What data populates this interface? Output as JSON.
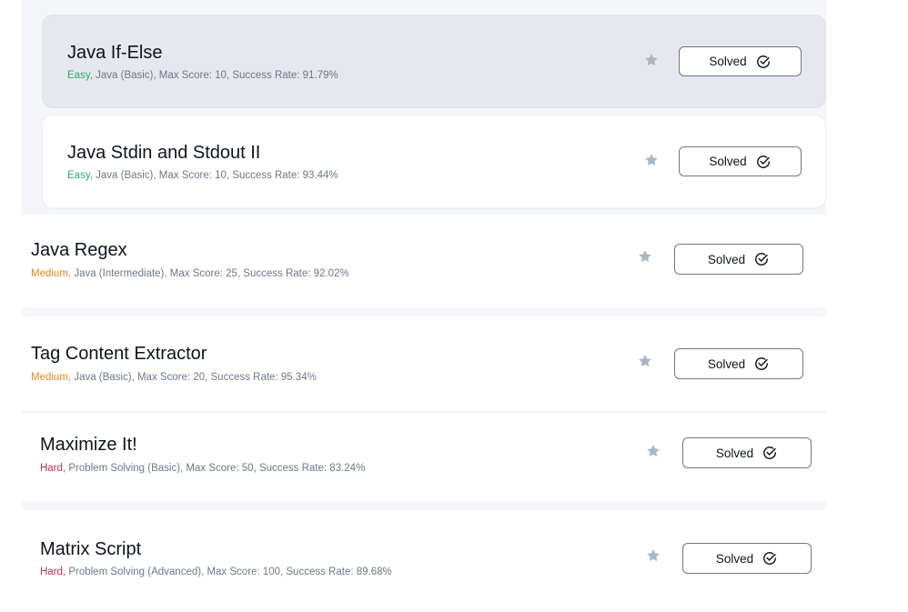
{
  "challenges": [
    {
      "title": "Java If-Else",
      "difficulty": "Easy,",
      "details": "Java (Basic), Max Score: 10, Success Rate: 91.79%",
      "button_label": "Solved"
    },
    {
      "title": "Java Stdin and Stdout II",
      "difficulty": "Easy,",
      "details": "Java (Basic), Max Score: 10, Success Rate: 93.44%",
      "button_label": "Solved"
    },
    {
      "title": "Java Regex",
      "difficulty": "Medium,",
      "details": "Java (Intermediate), Max Score: 25, Success Rate: 92.02%",
      "button_label": "Solved"
    },
    {
      "title": "Tag Content Extractor",
      "difficulty": "Medium,",
      "details": "Java (Basic), Max Score: 20, Success Rate: 95.34%",
      "button_label": "Solved"
    },
    {
      "title": "Maximize It!",
      "difficulty": "Hard,",
      "details": "Problem Solving (Basic), Max Score: 50, Success Rate: 83.24%",
      "button_label": "Solved"
    },
    {
      "title": "Matrix Script",
      "difficulty": "Hard,",
      "details": "Problem Solving (Advanced), Max Score: 100, Success Rate: 89.68%",
      "button_label": "Solved"
    }
  ],
  "icons": {
    "bookmark": "star-icon",
    "solved": "check-circle-icon"
  },
  "colors": {
    "easy": "#2ea86e",
    "medium": "#e38a1a",
    "hard": "#c0314f",
    "hover_background": "#e7e7f0",
    "star": "#a8b7c3"
  }
}
